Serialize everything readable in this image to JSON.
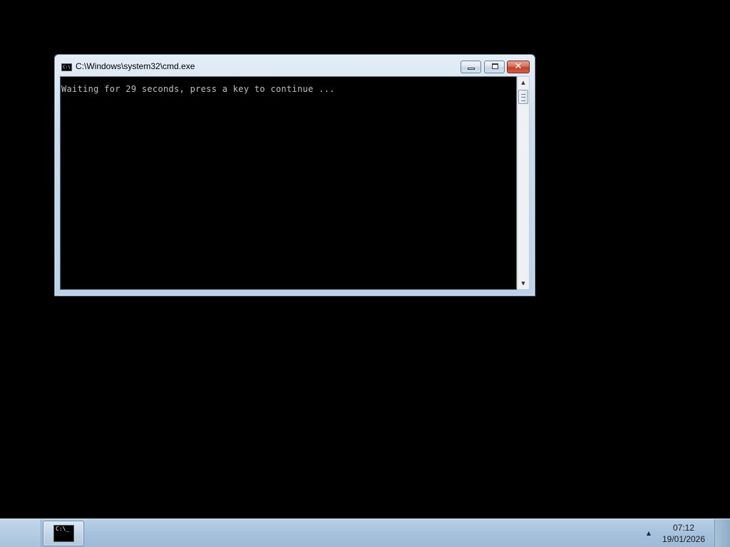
{
  "window": {
    "title": "C:\\Windows\\system32\\cmd.exe",
    "icon": "cmd-icon",
    "console_text": "Waiting for 29 seconds, press a key to continue ...",
    "buttons": {
      "minimize": "minimize-icon",
      "maximize": "maximize-icon",
      "close": "close-icon",
      "close_symbol": "✕"
    },
    "colors": {
      "console_bg": "#000000",
      "console_text": "#c0c0c0",
      "close_button": "#c0412a"
    }
  },
  "taskbar": {
    "task_buttons": [
      {
        "label_icon": "cmd-icon",
        "icon_text": "C:\\_"
      }
    ],
    "tray": {
      "show_hidden_icons": "▲",
      "time": "07:12",
      "date": "19/01/2026"
    }
  }
}
